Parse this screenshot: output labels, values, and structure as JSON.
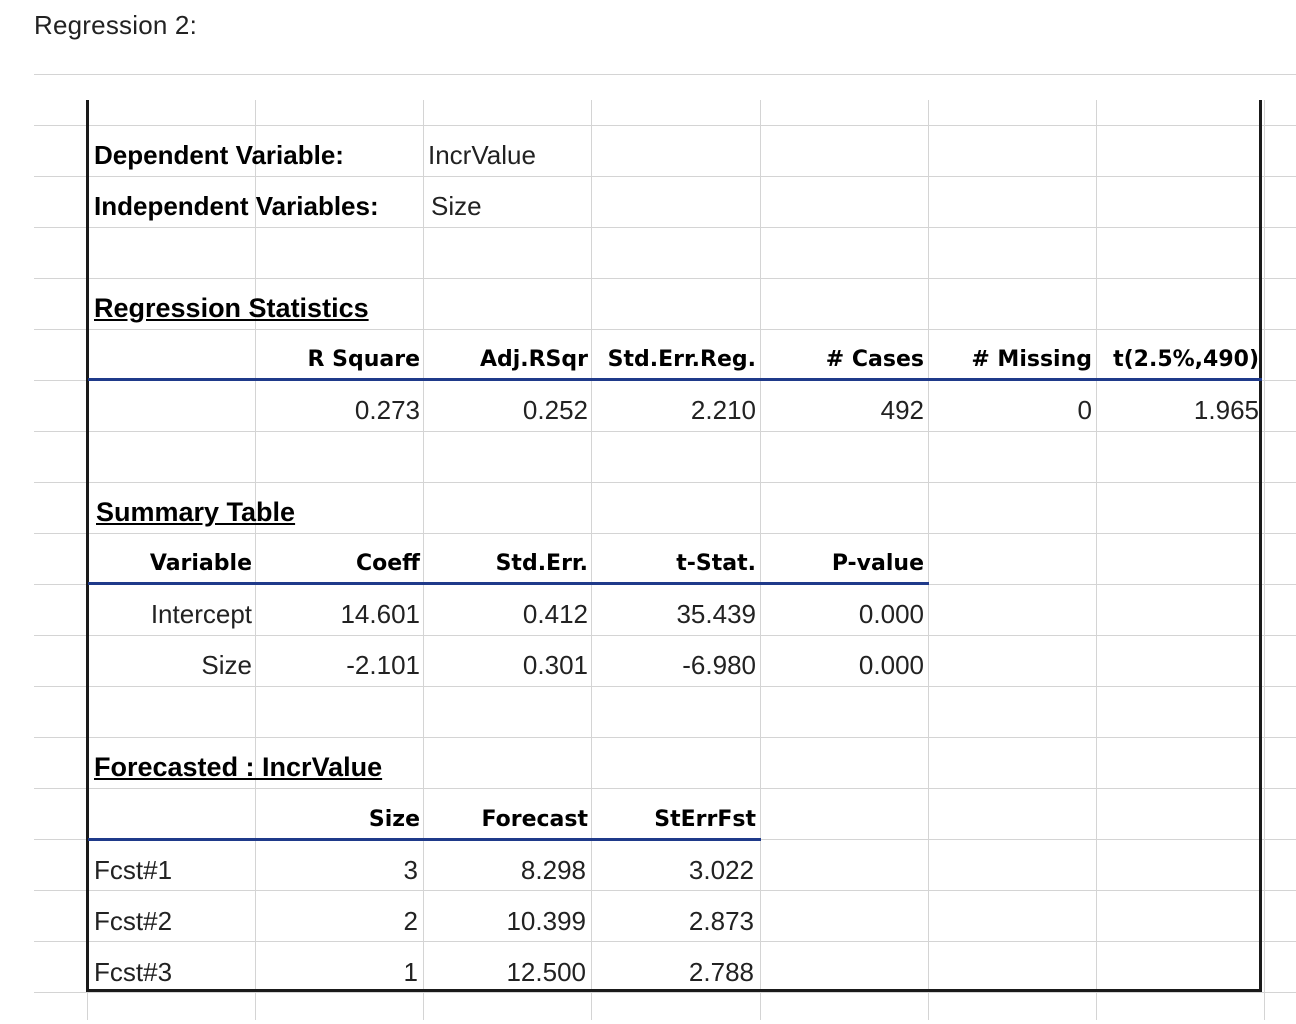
{
  "caption": "Regression 2:",
  "dependent_variable": {
    "label": "Dependent Variable:",
    "value": "IncrValue"
  },
  "independent_variables": {
    "label": "Independent Variables:",
    "value": "Size"
  },
  "regression_statistics": {
    "title": "Regression Statistics",
    "headers": [
      "R Square",
      "Adj.RSqr",
      "Std.Err.Reg.",
      "# Cases",
      "# Missing",
      "t(2.5%,490)"
    ],
    "values": [
      "0.273",
      "0.252",
      "2.210",
      "492",
      "0",
      "1.965"
    ]
  },
  "summary_table": {
    "title": "Summary Table",
    "headers": [
      "Variable",
      "Coeff",
      "Std.Err.",
      "t-Stat.",
      "P-value"
    ],
    "rows": [
      [
        "Intercept",
        "14.601",
        "0.412",
        "35.439",
        "0.000"
      ],
      [
        "Size",
        "-2.101",
        "0.301",
        "-6.980",
        "0.000"
      ]
    ]
  },
  "forecast": {
    "title": "Forecasted : IncrValue",
    "headers": [
      "Size",
      "Forecast",
      "StErrFst"
    ],
    "rows": [
      [
        "Fcst#1",
        "3",
        "8.298",
        "3.022"
      ],
      [
        "Fcst#2",
        "2",
        "10.399",
        "2.873"
      ],
      [
        "Fcst#3",
        "1",
        "12.500",
        "2.788"
      ]
    ]
  }
}
